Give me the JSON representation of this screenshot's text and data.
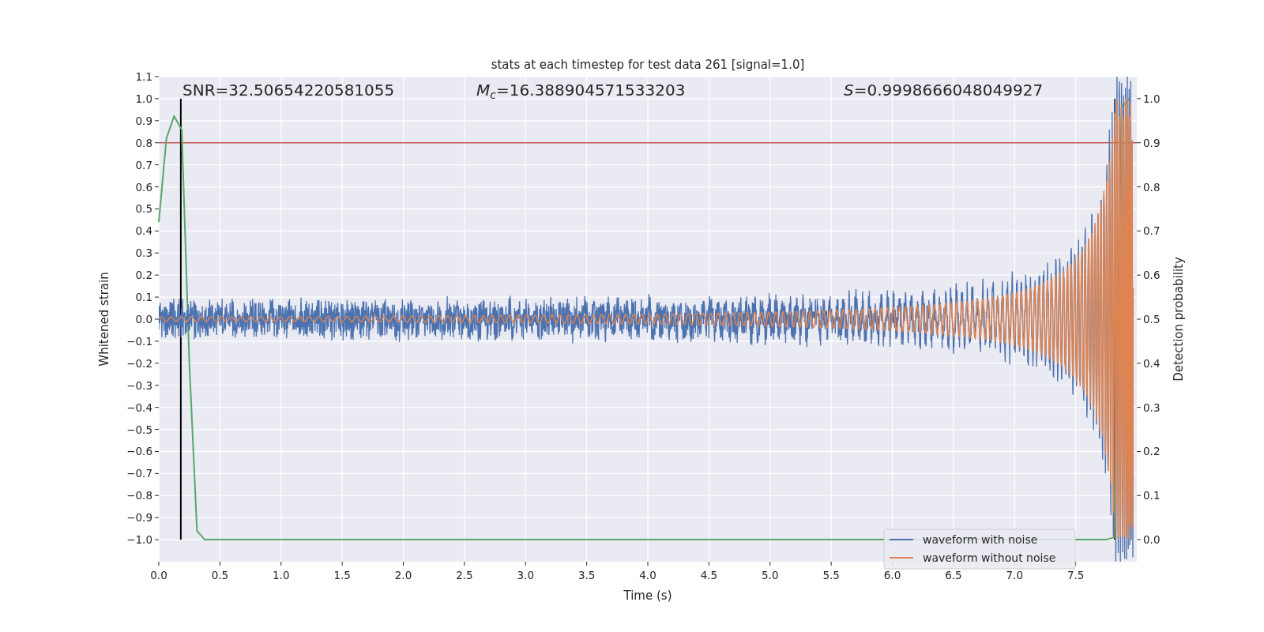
{
  "figure": {
    "title": "stats at each timestep for test data 261 [signal=1.0]",
    "labels": [
      "SNR=32.50654220581055",
      "*M*$_{c}$=16.388904571533203",
      "*S*=0.9998666048049927"
    ],
    "chart_data": {
      "type": "line",
      "xlabel": "Time (s)",
      "ylabel": "Whitened strain",
      "y2label": "Detection probability",
      "xlim": [
        0,
        8
      ],
      "ylim": [
        -1.1,
        1.1
      ],
      "y2lim": [
        -0.05,
        1.05
      ],
      "xticks": [
        {
          "value": 0,
          "label": "0.0"
        },
        {
          "value": 0.5,
          "label": "0.5"
        },
        {
          "value": 1,
          "label": "1.0"
        },
        {
          "value": 1.5,
          "label": "1.5"
        },
        {
          "value": 2,
          "label": "2.0"
        },
        {
          "value": 2.5,
          "label": "2.5"
        },
        {
          "value": 3,
          "label": "3.0"
        },
        {
          "value": 3.5,
          "label": "3.5"
        },
        {
          "value": 4,
          "label": "4.0"
        },
        {
          "value": 4.5,
          "label": "4.5"
        },
        {
          "value": 5,
          "label": "5.0"
        },
        {
          "value": 5.5,
          "label": "5.5"
        },
        {
          "value": 6,
          "label": "6.0"
        },
        {
          "value": 6.5,
          "label": "6.5"
        },
        {
          "value": 7,
          "label": "7.0"
        },
        {
          "value": 7.5,
          "label": "7.5"
        }
      ],
      "yticks": [
        {
          "value": 1.1,
          "label": "1.1"
        },
        {
          "value": 1,
          "label": "1.0"
        },
        {
          "value": 0.9,
          "label": "0.9"
        },
        {
          "value": 0.8,
          "label": "0.8"
        },
        {
          "value": 0.7,
          "label": "0.7"
        },
        {
          "value": 0.6,
          "label": "0.6"
        },
        {
          "value": 0.5,
          "label": "0.5"
        },
        {
          "value": 0.4,
          "label": "0.4"
        },
        {
          "value": 0.3,
          "label": "0.3"
        },
        {
          "value": 0.2,
          "label": "0.2"
        },
        {
          "value": 0.1,
          "label": "0.1"
        },
        {
          "value": 0,
          "label": "0.0"
        },
        {
          "value": -0.1,
          "label": "−0.1"
        },
        {
          "value": -0.2,
          "label": "−0.2"
        },
        {
          "value": -0.3,
          "label": "−0.3"
        },
        {
          "value": -0.4,
          "label": "−0.4"
        },
        {
          "value": -0.5,
          "label": "−0.5"
        },
        {
          "value": -0.6,
          "label": "−0.6"
        },
        {
          "value": -0.7,
          "label": "−0.7"
        },
        {
          "value": -0.8,
          "label": "−0.8"
        },
        {
          "value": -0.9,
          "label": "−0.9"
        },
        {
          "value": -1,
          "label": "−1.0"
        }
      ],
      "y2ticks": [
        {
          "value": 1,
          "label": "1.0"
        },
        {
          "value": 0.9,
          "label": "0.9"
        },
        {
          "value": 0.8,
          "label": "0.8"
        },
        {
          "value": 0.7,
          "label": "0.7"
        },
        {
          "value": 0.6,
          "label": "0.6"
        },
        {
          "value": 0.5,
          "label": "0.5"
        },
        {
          "value": 0.4,
          "label": "0.4"
        },
        {
          "value": 0.3,
          "label": "0.3"
        },
        {
          "value": 0.2,
          "label": "0.2"
        },
        {
          "value": 0.1,
          "label": "0.1"
        },
        {
          "value": 0,
          "label": "0.0"
        }
      ],
      "x": [
        0,
        0.0625,
        0.125,
        0.1875,
        0.25,
        0.3125,
        0.375,
        7.75,
        7.8125,
        7.875,
        7.9375
      ],
      "series": [
        {
          "name": "waveform with noise",
          "color": "#4c72b0",
          "values": [
            null,
            null,
            null,
            null,
            null,
            null,
            null,
            null,
            null,
            null,
            null
          ]
        },
        {
          "name": "waveform without noise",
          "color": "#dd8452",
          "values": [
            null,
            null,
            null,
            null,
            null,
            null,
            null,
            null,
            null,
            null,
            null
          ]
        },
        {
          "color": "#55a868",
          "axis": "y2",
          "values": [
            0.72,
            0.91,
            0.96,
            0.93,
            0.4,
            0.02,
            0,
            0,
            0.005,
            0.98,
            1.0
          ]
        }
      ],
      "grid": true,
      "ref_lines": [
        {
          "axis": "y",
          "value": 0.8
        },
        {
          "axis": "x",
          "value": 0.18
        },
        {
          "axis": "x",
          "value": 7.82
        }
      ]
    }
  }
}
